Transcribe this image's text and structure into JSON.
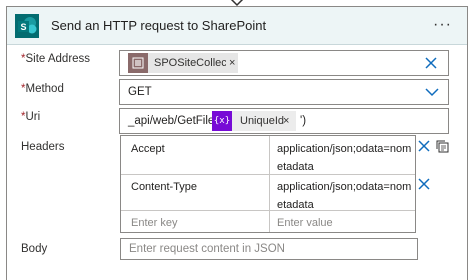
{
  "header": {
    "title": "Send an HTTP request to SharePoint",
    "more_label": "···",
    "accent": "#036c70"
  },
  "site_address": {
    "required_mark": "*",
    "label": "Site Address",
    "token_label": "SPOSiteCollecti...",
    "token_remove": "×"
  },
  "method": {
    "required_mark": "*",
    "label": "Method",
    "value": "GET"
  },
  "uri": {
    "required_mark": "*",
    "label": "Uri",
    "prefix": "_api/web/GetFileById('",
    "token_icon": "{x}",
    "token_label": "UniqueId",
    "token_remove": "×",
    "suffix": "')"
  },
  "headers": {
    "label": "Headers",
    "rows": [
      {
        "key": "Accept",
        "value": "application/json;odata=nometadata"
      },
      {
        "key": "Content-Type",
        "value": "application/json;odata=nometadata"
      }
    ],
    "key_placeholder": "Enter key",
    "value_placeholder": "Enter value"
  },
  "body": {
    "label": "Body",
    "placeholder": "Enter request content in JSON"
  },
  "colors": {
    "icon_blue": "#0f6cbd",
    "required_red": "#a4262c",
    "variable_purple": "#770bd6"
  }
}
